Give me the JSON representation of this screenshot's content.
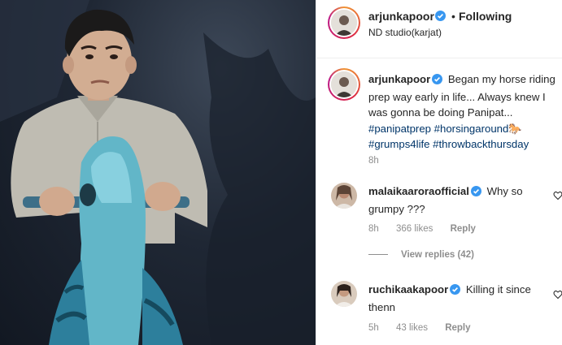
{
  "post": {
    "author": "arjunkapoor",
    "follow_status": "Following",
    "separator": "•",
    "location": "ND studio(karjat)"
  },
  "caption": {
    "username": "arjunkapoor",
    "text": "Began my horse riding prep way early in life... Always knew I was gonna be doing Panipat...",
    "hashtags": [
      "#panipatprep",
      "#horsingaround🐎",
      "#grumps4life",
      "#throwbackthursday"
    ],
    "time": "8h"
  },
  "comments": [
    {
      "username": "malaikaaroraofficial",
      "text": "Why so grumpy ???",
      "time": "8h",
      "likes": "366 likes",
      "reply_label": "Reply",
      "view_replies": "View replies (42)"
    },
    {
      "username": "ruchikaakapoor",
      "text": "Killing it since thenn",
      "time": "5h",
      "likes": "43 likes",
      "reply_label": "Reply"
    }
  ],
  "icons": {
    "verified": "verified-badge-icon",
    "like": "heart-icon"
  },
  "colors": {
    "verified_blue": "#3897f0",
    "hashtag": "#003569",
    "muted": "#8e8e8e"
  }
}
